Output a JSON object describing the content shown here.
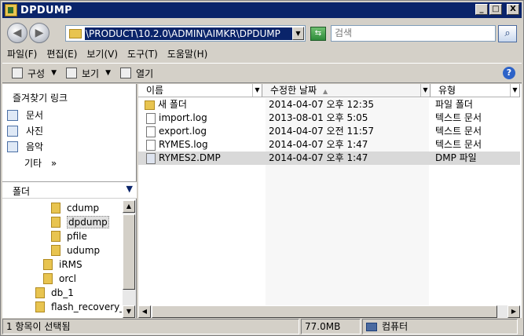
{
  "window": {
    "title": "DPDUMP",
    "controls": [
      "_",
      "□",
      "X"
    ]
  },
  "address": {
    "path": "\\PRODUCT\\10.2.0\\ADMIN\\AIMKR\\DPDUMP",
    "search_placeholder": "검색"
  },
  "menu": [
    "파일(F)",
    "편집(E)",
    "보기(V)",
    "도구(T)",
    "도움말(H)"
  ],
  "toolbar": {
    "organize": "구성",
    "views": "보기",
    "open": "열기",
    "help": "?"
  },
  "favorites": {
    "title": "즐겨찾기 링크",
    "items": [
      "문서",
      "사진",
      "음악"
    ],
    "more": "기타",
    "more_arrow": "»"
  },
  "folders": {
    "title": "폴더",
    "tree": [
      {
        "label": "cdump"
      },
      {
        "label": "dpdump"
      },
      {
        "label": "pfile"
      },
      {
        "label": "udump"
      },
      {
        "label": "iRMS"
      },
      {
        "label": "orcl"
      },
      {
        "label": "db_1"
      },
      {
        "label": "flash_recovery_a"
      }
    ]
  },
  "columns": [
    "이름",
    "수정한 날짜",
    "유형"
  ],
  "files": [
    {
      "name": "새 폴더",
      "date": "2014-04-07 오후 12:35",
      "type": "파일 폴더",
      "icon": "folder-icon"
    },
    {
      "name": "import.log",
      "date": "2013-08-01 오후 5:05",
      "type": "텍스트 문서",
      "icon": "file-icon"
    },
    {
      "name": "export.log",
      "date": "2014-04-07 오전 11:57",
      "type": "텍스트 문서",
      "icon": "file-icon"
    },
    {
      "name": "RYMES.log",
      "date": "2014-04-07 오후 1:47",
      "type": "텍스트 문서",
      "icon": "file-icon"
    },
    {
      "name": "RYMES2.DMP",
      "date": "2014-04-07 오후 1:47",
      "type": "DMP 파일",
      "icon": "file-icon",
      "selected": true
    }
  ],
  "status": {
    "selection": "1 항목이 선택됨",
    "size": "77.0MB",
    "location": "컴퓨터"
  },
  "colors": {
    "title_bar": "#0a246a",
    "selection_highlight": "#d9d9d9",
    "window_face": "#d4d0c8"
  }
}
